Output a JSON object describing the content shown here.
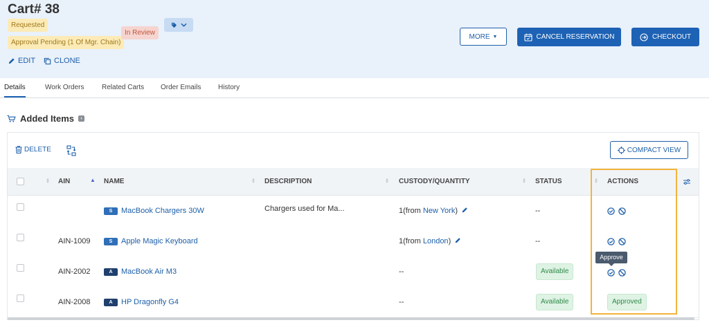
{
  "header": {
    "title": "Cart# 38",
    "badges": {
      "requested": "Requested",
      "approval_pending": "Approval Pending (1 Of Mgr. Chain)",
      "in_review": "In Review"
    },
    "edit_label": "EDIT",
    "clone_label": "CLONE",
    "more_label": "MORE",
    "cancel_reservation_label": "CANCEL RESERVATION",
    "checkout_label": "CHECKOUT"
  },
  "tabs": [
    "Details",
    "Work Orders",
    "Related Carts",
    "Order Emails",
    "History"
  ],
  "section": {
    "title": "Added Items"
  },
  "toolbar": {
    "delete_label": "DELETE",
    "compact_view_label": "COMPACT VIEW"
  },
  "table": {
    "columns": {
      "ain": "AIN",
      "name": "NAME",
      "description": "DESCRIPTION",
      "custody": "CUSTODY/QUANTITY",
      "status": "STATUS",
      "actions": "ACTIONS"
    },
    "rows": [
      {
        "ain": "",
        "type": "S",
        "name": "MacBook Chargers 30W",
        "description": "Chargers used for Ma...",
        "custody_prefix": "1(from ",
        "location": "New York",
        "custody_suffix": ")",
        "status": "--",
        "action": ""
      },
      {
        "ain": "AIN-1009",
        "type": "S",
        "name": "Apple Magic Keyboard",
        "description": "",
        "custody_prefix": "1(from ",
        "location": "London",
        "custody_suffix": ")",
        "status": "--",
        "action": ""
      },
      {
        "ain": "AIN-2002",
        "type": "A",
        "name": "MacBook Air M3",
        "description": "",
        "custody_prefix": "--",
        "location": "",
        "custody_suffix": "",
        "status": "Available",
        "action": ""
      },
      {
        "ain": "AIN-2008",
        "type": "A",
        "name": "HP Dragonfly G4",
        "description": "",
        "custody_prefix": "--",
        "location": "",
        "custody_suffix": "",
        "status": "Available",
        "action": "Approved"
      }
    ]
  },
  "tooltip": "Approve",
  "colors": {
    "accent": "#1d62b4",
    "highlight": "#f2b43c",
    "success_bg": "#dff3e4",
    "success_text": "#2f8a4a"
  }
}
